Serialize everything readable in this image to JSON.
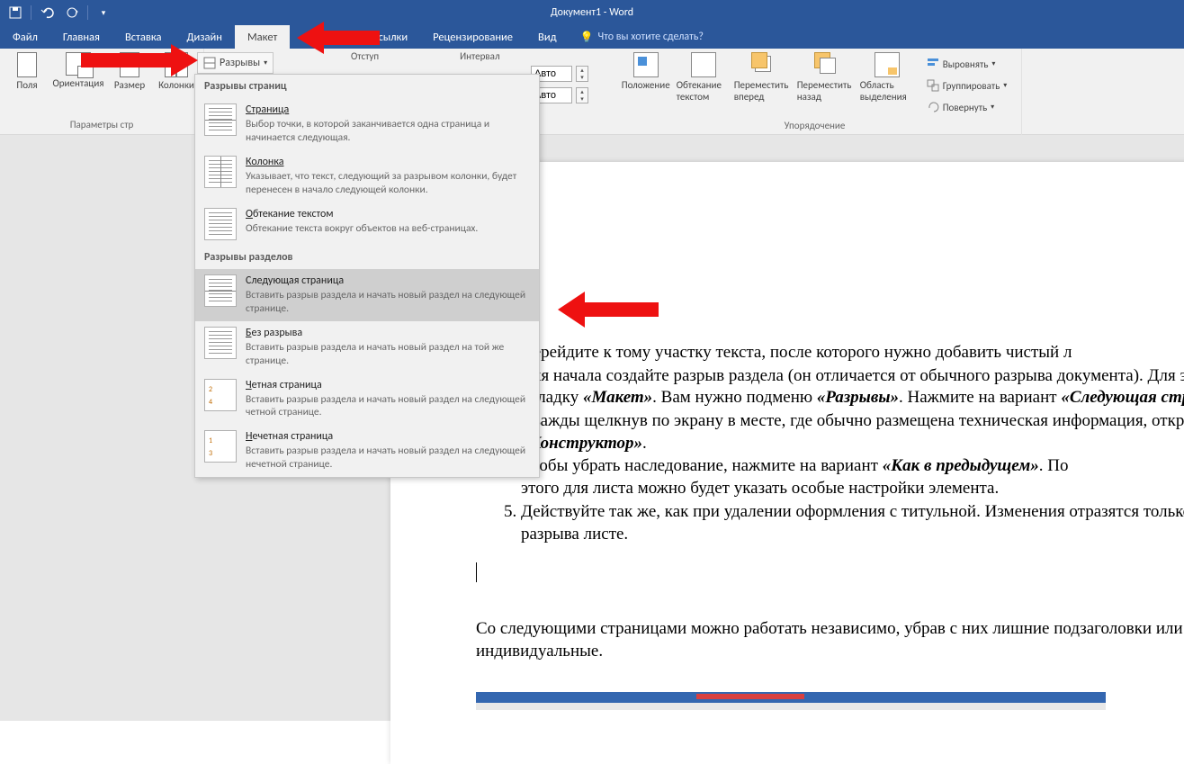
{
  "title": "Документ1 - Word",
  "qat": {
    "save": "save-icon",
    "undo": "undo-icon",
    "redo": "redo-icon",
    "custom": "qat-custom-icon"
  },
  "tabs": {
    "file": "Файл",
    "home": "Главная",
    "insert": "Вставка",
    "design": "Дизайн",
    "layout": "Макет",
    "letters_partial": "ки",
    "mailings": "Рассылки",
    "review": "Рецензирование",
    "view": "Вид",
    "tellme": "Что вы хотите сделать?"
  },
  "ribbon": {
    "margins": "Поля",
    "orientation": "Ориентация",
    "size": "Размер",
    "columns": "Колонки",
    "breaks": "Разрывы",
    "page_setup": "Параметры стр",
    "indent": "Отступ",
    "spacing": "Интервал",
    "auto": "Авто",
    "position": "Положение",
    "wrap": "Обтекание текстом",
    "bring_forward": "Переместить вперед",
    "send_back": "Переместить назад",
    "selection_pane": "Область выделения",
    "align": "Выровнять",
    "group": "Группировать",
    "rotate": "Повернуть",
    "arrange": "Упорядочение"
  },
  "breaks_menu": {
    "h1": "Разрывы страниц",
    "h2": "Разрывы разделов",
    "page_t": "Страница",
    "page_d": "Выбор точки, в которой заканчивается одна страница и начинается следующая.",
    "col_t": "Колонка",
    "col_d": "Указывает, что текст, следующий за разрывом колонки, будет перенесен в начало следующей колонки.",
    "wrap_t": "Обтекание текстом",
    "wrap_d": "Обтекание текста вокруг объектов на веб-страницах.",
    "next_t": "Следующая страница",
    "next_d": "Вставить разрыв раздела и начать новый раздел на следующей странице.",
    "cont_t": "Без разрыва",
    "cont_d": "Вставить разрыв раздела и начать новый раздел на той же странице.",
    "even_t": "Четная страница",
    "even_d": "Вставить разрыв раздела и начать новый раздел на следующей четной странице.",
    "odd_t": "Нечетная страница",
    "odd_d": "Вставить разрыв раздела и начать новый раздел на следующей нечетной странице."
  },
  "doc": {
    "li1a": "Перейдите к тому участку текста, после которого нужно добавить чистый л",
    "li2a": "Для начала создайте разрыв раздела (он отличается от обычного разрыва документа). Для этого откройте вкладку ",
    "li2m1": "«Макет»",
    "li2b": ". Вам нужно подменю ",
    "li2m2": "«Разрывы»",
    "li2c": ". Нажмите на вариант ",
    "li2m3": "«Следующая страница»",
    "li2d": ".",
    "li3a": "Дважды щелкнув по экрану в месте, где обычно размещена техническая информация, откройте ",
    "li3m": "«Конструктор»",
    "li3b": ".",
    "li4a": "Чтобы убрать наследование, нажмите на вариант ",
    "li4m": "«Как в предыдущем»",
    "li4b": ". По",
    "li4c": "этого для листа можно будет указать особые настройки элемента.",
    "li5": "Действуйте так же, как при удалении оформления с титульной. Изменения отразятся только на первом после разрыва листе.",
    "p1": "Со следующими страницами можно работать независимо, убрав с них лишние подзаголовки или проставив индивидуальные."
  }
}
